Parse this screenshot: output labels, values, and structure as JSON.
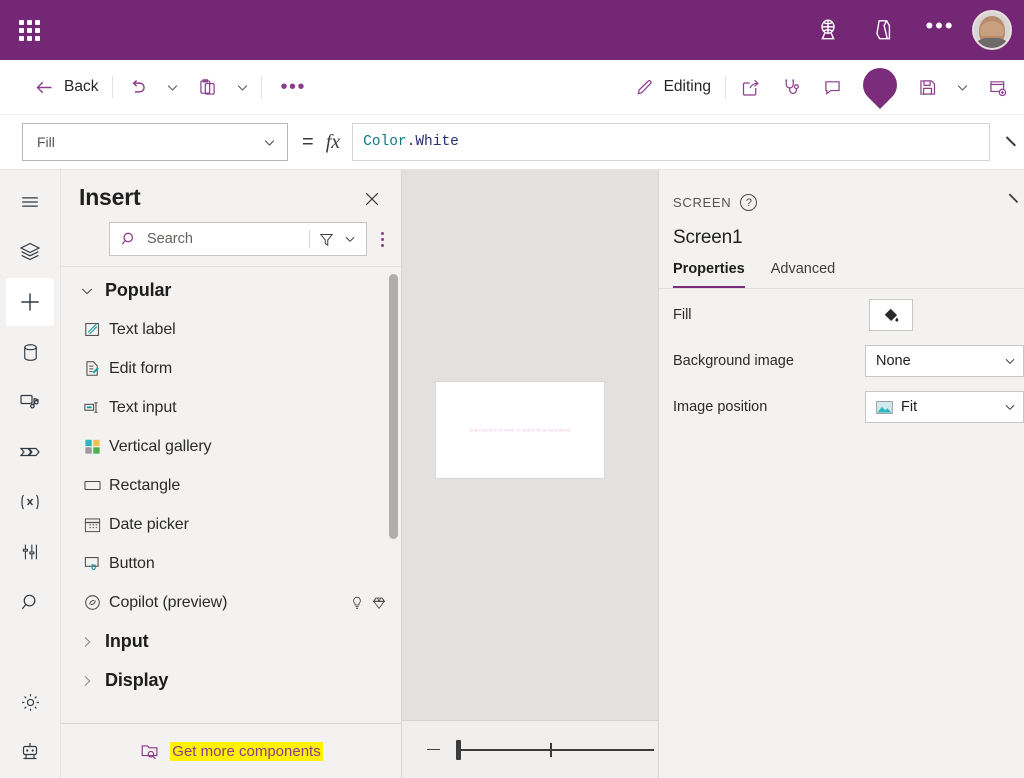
{
  "appbar": {
    "waffle_label": "App launcher",
    "icons": [
      {
        "name": "environment-icon",
        "label": "Environment"
      },
      {
        "name": "apps-icon",
        "label": "Apps"
      }
    ],
    "more_label": "•••",
    "avatar_label": "Account manager"
  },
  "toolbar": {
    "back_label": "Back",
    "undo_label": "Undo",
    "undo_chevron": "Undo options",
    "paste_label": "Paste",
    "paste_chevron": "Paste options",
    "more_label": "•••",
    "editing_label": "Editing",
    "share_label": "Share",
    "checker_label": "App checker",
    "comments_label": "Comments",
    "copilot_label": "Copilot",
    "save_label": "Save",
    "save_chevron": "Save options",
    "publish_label": "Publish"
  },
  "formula_bar": {
    "property": "Fill",
    "equals": "=",
    "fx": "fx",
    "formula_function": "Color",
    "formula_member": ".White",
    "expand_label": "Expand formula bar"
  },
  "rail": {
    "items": [
      {
        "name": "menu-icon",
        "label": "Menu",
        "selected": false
      },
      {
        "name": "tree-view-icon",
        "label": "Tree view",
        "selected": false
      },
      {
        "name": "insert-icon",
        "label": "Insert",
        "selected": true
      },
      {
        "name": "data-icon",
        "label": "Data",
        "selected": false
      },
      {
        "name": "media-icon",
        "label": "Media",
        "selected": false
      },
      {
        "name": "power-automate-icon",
        "label": "Power Automate",
        "selected": false
      },
      {
        "name": "variables-icon",
        "label": "Variables",
        "selected": false
      },
      {
        "name": "tools-icon",
        "label": "Tools",
        "selected": false
      },
      {
        "name": "search-icon",
        "label": "Search",
        "selected": false
      }
    ],
    "bottom_items": [
      {
        "name": "settings-gear-icon",
        "label": "Settings"
      },
      {
        "name": "agent-bot-icon",
        "label": "Agents"
      }
    ]
  },
  "insert_panel": {
    "title": "Insert",
    "close_label": "Close",
    "search_placeholder": "Search",
    "filter_label": "Filter",
    "filter_chevron_label": "Filter options",
    "more_options_label": "More options",
    "groups": [
      {
        "name": "Popular",
        "expanded": true,
        "items": [
          {
            "label": "Text label",
            "icon": "text-label-icon"
          },
          {
            "label": "Edit form",
            "icon": "edit-form-icon"
          },
          {
            "label": "Text input",
            "icon": "text-input-icon"
          },
          {
            "label": "Vertical gallery",
            "icon": "vertical-gallery-icon"
          },
          {
            "label": "Rectangle",
            "icon": "rectangle-icon"
          },
          {
            "label": "Date picker",
            "icon": "date-picker-icon"
          },
          {
            "label": "Button",
            "icon": "button-icon"
          },
          {
            "label": "Copilot (preview)",
            "icon": "copilot-icon",
            "badges": [
              "lightbulb-icon",
              "premium-diamond-icon"
            ]
          }
        ]
      },
      {
        "name": "Input",
        "expanded": false,
        "items": []
      },
      {
        "name": "Display",
        "expanded": false,
        "items": []
      }
    ],
    "footer_label": "Get more components",
    "footer_icon": "folder-search-icon"
  },
  "canvas": {
    "screen_hint": "Select an item to insert, or search for an item above",
    "zoom_out_label": "Zoom out",
    "zoom_slider_label": "Zoom"
  },
  "properties_panel": {
    "kind": "SCREEN",
    "help_label": "?",
    "collapse_label": "Collapse pane",
    "selected_name": "Screen1",
    "tabs": [
      {
        "label": "Properties",
        "active": true
      },
      {
        "label": "Advanced",
        "active": false
      }
    ],
    "rows": [
      {
        "label": "Fill",
        "control": "color",
        "value": "",
        "icon": "paint-bucket-icon"
      },
      {
        "label": "Background image",
        "control": "dropdown",
        "value": "None",
        "icon": ""
      },
      {
        "label": "Image position",
        "control": "dropdown",
        "value": "Fit",
        "icon": "image-icon"
      }
    ]
  },
  "colors": {
    "brand_purple": "#742774",
    "accent_purple": "#7b2d7b",
    "teal": "#0f7a85",
    "highlight_yellow": "#fff200",
    "panel_gray": "#f3f2f1",
    "canvas_gray": "#e3e1e0"
  }
}
